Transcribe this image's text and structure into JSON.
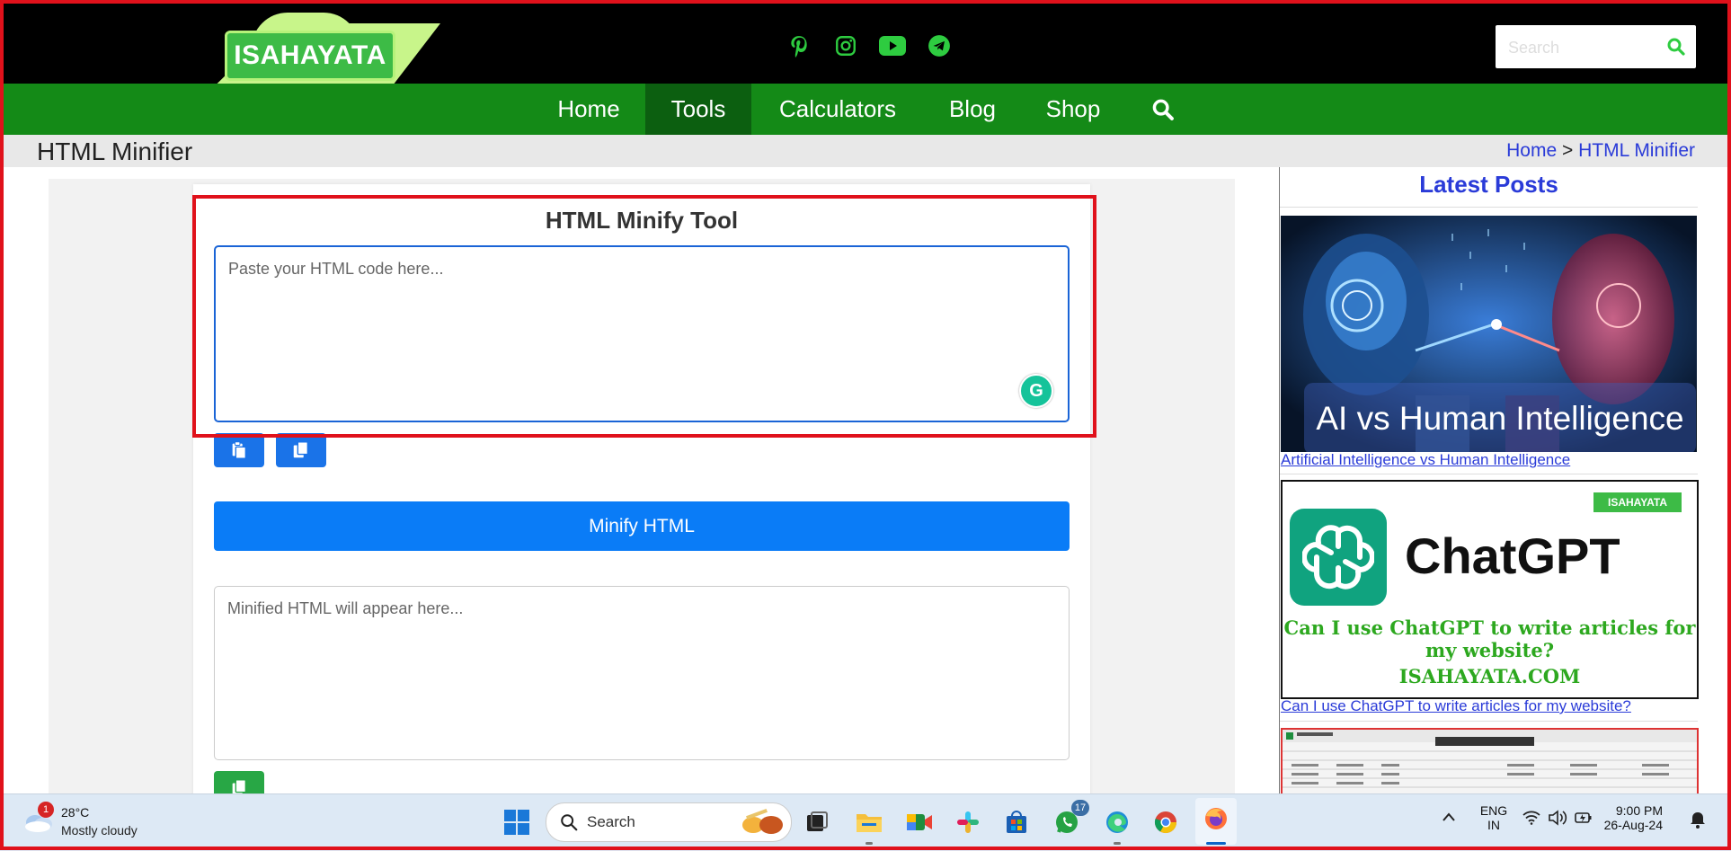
{
  "header": {
    "logo_text": "ISAHAYATA",
    "social_icons": [
      "pinterest-icon",
      "instagram-icon",
      "youtube-icon",
      "telegram-icon"
    ],
    "search_placeholder": "Search"
  },
  "nav": {
    "items": [
      "Home",
      "Tools",
      "Calculators",
      "Blog",
      "Shop"
    ],
    "active": "Tools"
  },
  "title_bar": {
    "page_title": "HTML Minifier",
    "breadcrumb_home": "Home",
    "breadcrumb_sep": ">",
    "breadcrumb_current": "HTML Minifier"
  },
  "tool": {
    "title": "HTML Minify Tool",
    "input_placeholder": "Paste your HTML code here...",
    "minify_label": "Minify HTML",
    "output_placeholder": "Minified HTML will appear here..."
  },
  "sidebar": {
    "title": "Latest Posts",
    "posts": [
      {
        "image_caption": "AI vs Human Intelligence",
        "link": "Artificial Intelligence vs Human Intelligence"
      },
      {
        "image_title": "ChatGPT",
        "image_badge": "ISAHAYATA",
        "image_question": "Can I use ChatGPT to write articles for my website?",
        "image_site": "ISAHAYATA.COM",
        "link": "Can I use ChatGPT to write articles for my website?"
      }
    ]
  },
  "taskbar": {
    "weather_temp": "28°C",
    "weather_desc": "Mostly cloudy",
    "weather_badge": "1",
    "search_label": "Search",
    "whatsapp_badge": "17",
    "lang_line1": "ENG",
    "lang_line2": "IN",
    "time": "9:00 PM",
    "date": "26-Aug-24"
  },
  "colors": {
    "nav_green": "#148a17",
    "nav_active": "#0c5f10",
    "link_blue": "#2a3bd8",
    "button_blue": "#0a7cf7",
    "highlight_red": "#e0111b"
  }
}
